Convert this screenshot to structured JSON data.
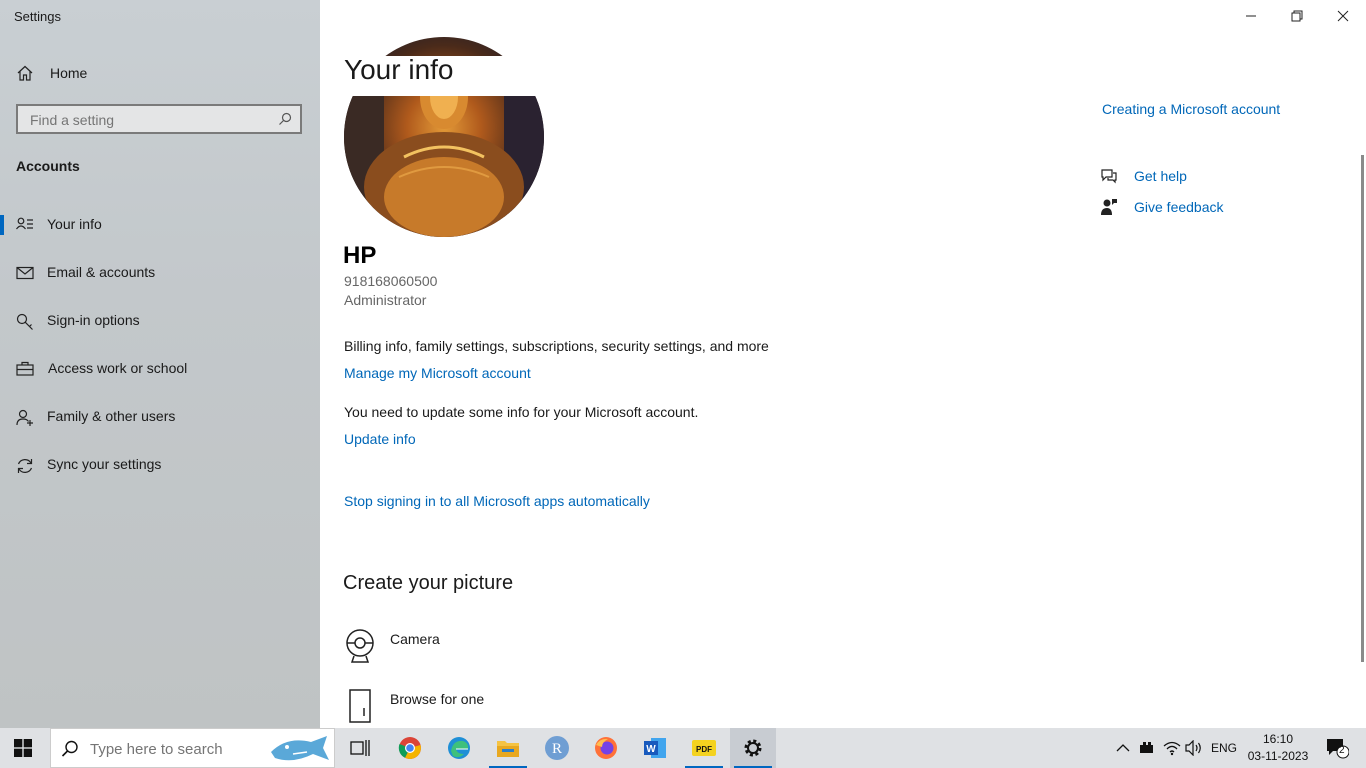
{
  "window": {
    "title": "Settings"
  },
  "sidebar": {
    "home_label": "Home",
    "search_placeholder": "Find a setting",
    "section_title": "Accounts",
    "items": [
      {
        "label": "Your info",
        "icon": "person-card-icon",
        "active": true
      },
      {
        "label": "Email & accounts",
        "icon": "mail-icon"
      },
      {
        "label": "Sign-in options",
        "icon": "key-icon"
      },
      {
        "label": "Access work or school",
        "icon": "briefcase-icon"
      },
      {
        "label": "Family & other users",
        "icon": "person-add-icon"
      },
      {
        "label": "Sync your settings",
        "icon": "sync-icon"
      }
    ]
  },
  "main": {
    "title": "Your info",
    "user": {
      "name": "HP",
      "phone": "918168060500",
      "role": "Administrator"
    },
    "billing_text": "Billing info, family settings, subscriptions, security settings, and more",
    "manage_link": "Manage my Microsoft account",
    "update_text": "You need to update some info for your Microsoft account.",
    "update_link": "Update info",
    "stop_link": "Stop signing in to all Microsoft apps automatically",
    "picture_heading": "Create your picture",
    "picture_options": [
      "Camera",
      "Browse for one"
    ]
  },
  "related": {
    "creating_link": "Creating a Microsoft account",
    "get_help": "Get help",
    "give_feedback": "Give feedback"
  },
  "taskbar": {
    "search_placeholder": "Type here to search",
    "apps": [
      "Task View",
      "Google Chrome",
      "Microsoft Edge",
      "File Explorer",
      "R",
      "Firefox",
      "Microsoft Word",
      "PDF",
      "Settings"
    ],
    "language": "ENG",
    "time": "16:10",
    "date": "03-11-2023",
    "notification_count": "2"
  },
  "colors": {
    "accent": "#0067c0",
    "link": "#0067b8"
  }
}
